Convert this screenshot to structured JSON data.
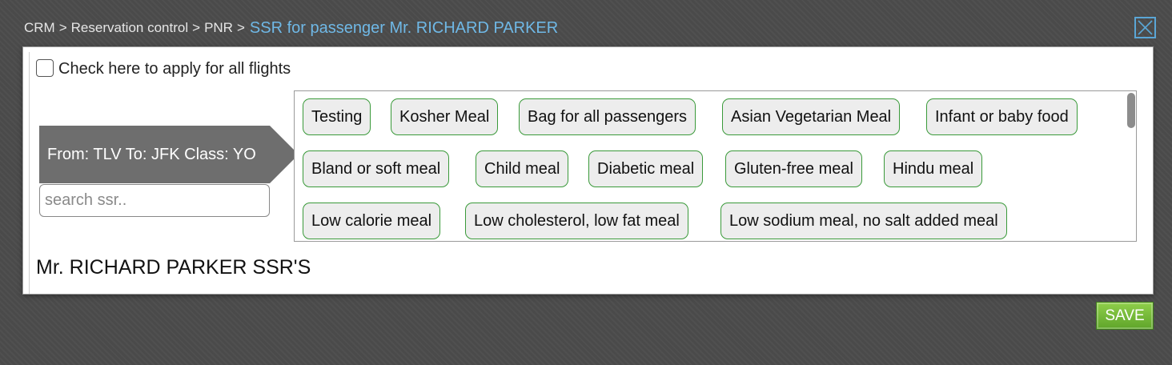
{
  "breadcrumb": {
    "items": [
      "CRM",
      "Reservation control",
      "PNR"
    ],
    "separator": ">",
    "current": "SSR for passenger Mr. RICHARD PARKER"
  },
  "close_icon": "close-x-icon",
  "apply_all": {
    "label": "Check here to apply for all flights",
    "checked": false
  },
  "flight": {
    "label": "From: TLV To: JFK Class: YO"
  },
  "search": {
    "placeholder": "search ssr..",
    "value": ""
  },
  "ssr_options": [
    [
      "Testing",
      "Kosher Meal",
      "Bag for all passengers",
      "Asian Vegetarian Meal",
      "Infant or baby food"
    ],
    [
      "Bland or soft meal",
      "Child meal",
      "Diabetic meal",
      "Gluten-free meal",
      "Hindu meal"
    ],
    [
      "Low calorie meal",
      "Low cholesterol, low fat meal",
      "Low sodium meal, no salt added meal"
    ]
  ],
  "passenger_heading": "Mr. RICHARD PARKER SSR'S",
  "save_label": "SAVE",
  "colors": {
    "accent_link": "#6fb8e6",
    "chip_border": "#3a9a3a",
    "save_green": "#6fb535",
    "flight_tag": "#6e6e6e"
  }
}
